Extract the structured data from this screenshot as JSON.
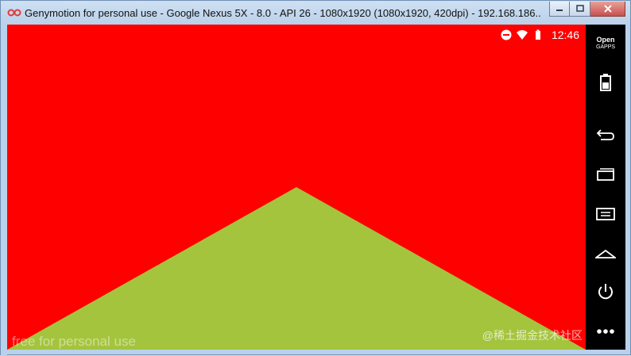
{
  "window": {
    "title": "Genymotion for personal use - Google Nexus 5X - 8.0 - API 26 - 1080x1920 (1080x1920, 420dpi) - 192.168.186...",
    "buttons": [
      "minimize-icon",
      "maximize-icon",
      "close-icon"
    ]
  },
  "device": {
    "status_bar": {
      "icons": [
        "do-not-disturb-icon",
        "wifi-icon",
        "battery-icon"
      ],
      "time": "12:46"
    },
    "screen_colors": {
      "background": "#ff0000",
      "triangle": "#a4c43e"
    },
    "watermark_left": "free for personal use",
    "watermark_right": "@稀土掘金技术社区"
  },
  "sidebar": {
    "gapps_line1": "Open",
    "gapps_line2": "GAPPS",
    "buttons": [
      "battery-icon",
      "back-icon",
      "recent-apps-icon",
      "menu-icon",
      "home-icon",
      "power-icon",
      "more-icon"
    ]
  }
}
